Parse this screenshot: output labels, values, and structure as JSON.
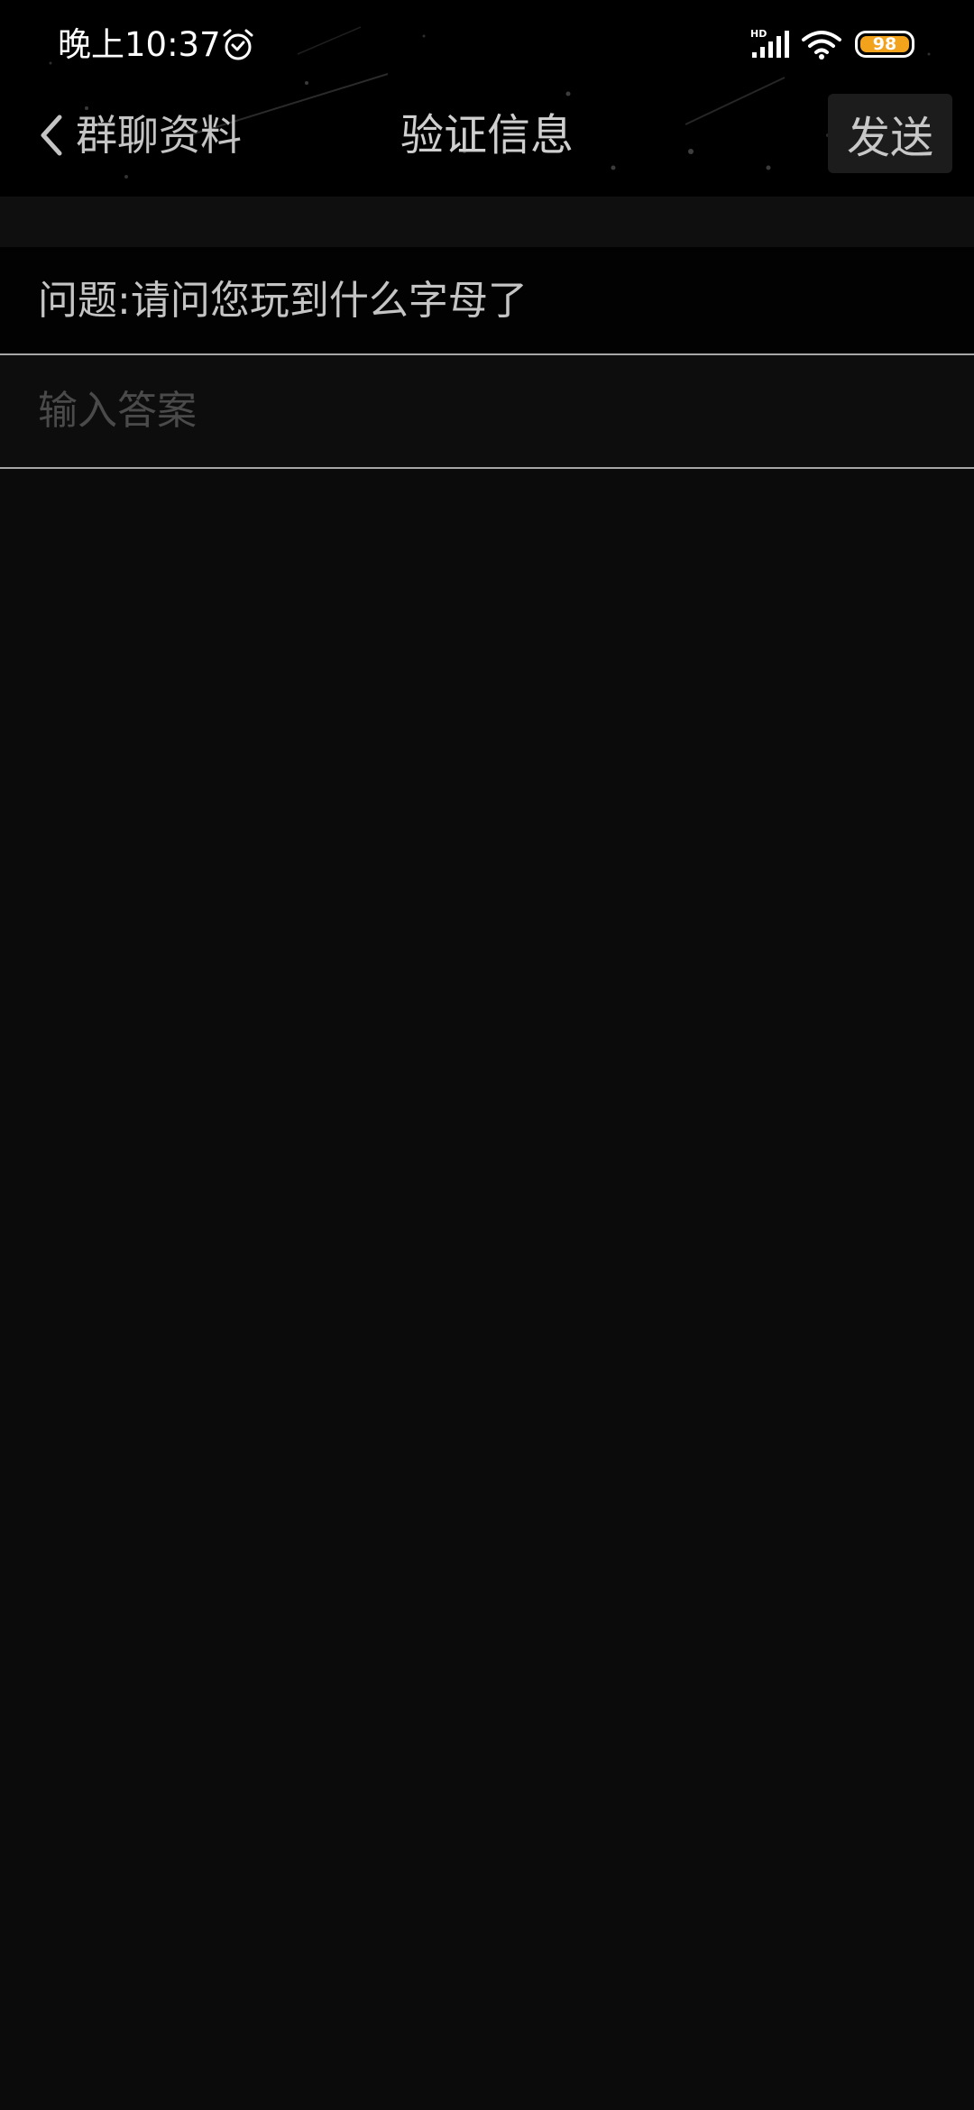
{
  "status_bar": {
    "time": "晚上10:37",
    "battery_level": "98",
    "signal_label": "HD",
    "icons": [
      "alarm-icon",
      "hd-signal-icon",
      "wifi-icon",
      "battery-icon"
    ],
    "battery_color": "#f3a21b"
  },
  "nav": {
    "back_label": "群聊资料",
    "title": "验证信息",
    "send_label": "发送"
  },
  "form": {
    "question": "问题:请问您玩到什么字母了",
    "answer_value": "",
    "answer_placeholder": "输入答案"
  }
}
